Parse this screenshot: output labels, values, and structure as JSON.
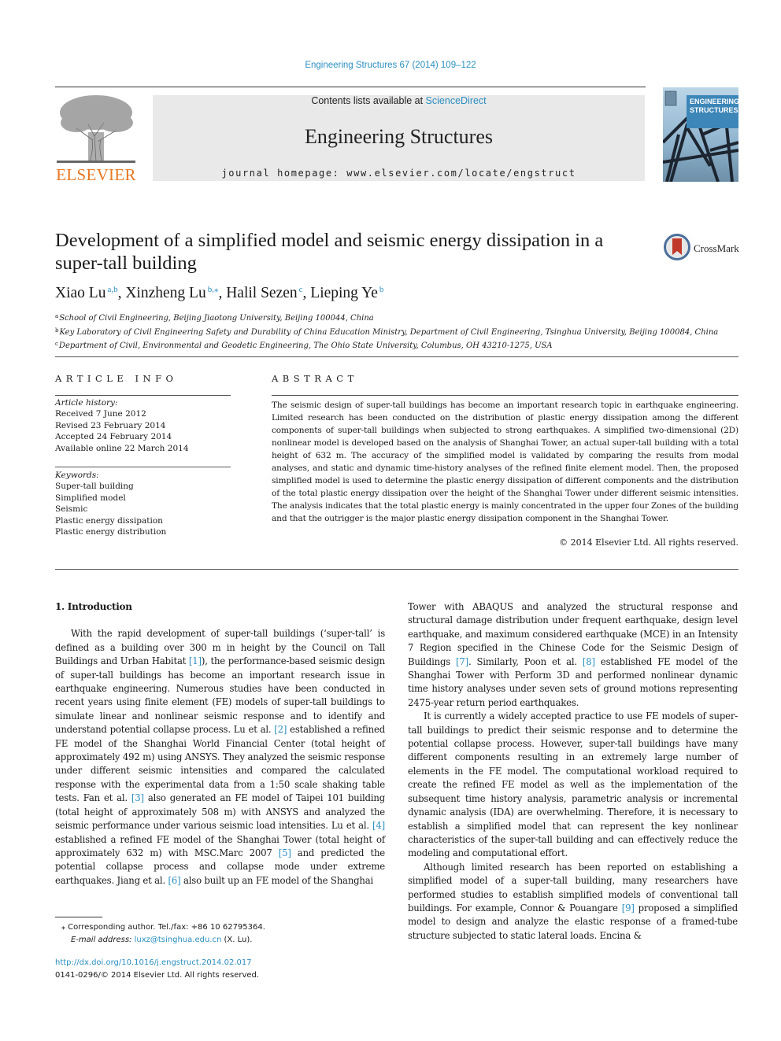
{
  "header": {
    "journal_ref": "Engineering Structures 67 (2014) 109–122",
    "contents_prefix": "Contents lists available at ",
    "contents_link": "ScienceDirect",
    "journal_title": "Engineering Structures",
    "homepage": "journal homepage: www.elsevier.com/locate/engstruct",
    "publisher_logo_text": "ELSEVIER",
    "cover_title_line1": "ENGINEERING",
    "cover_title_line2": "STRUCTURES",
    "crossmark_label": "CrossMark"
  },
  "article": {
    "title": "Development of a simplified model and seismic energy dissipation in a super-tall building",
    "authors": [
      {
        "name": "Xiao Lu",
        "sup": "a,b",
        "sep": ", "
      },
      {
        "name": "Xinzheng Lu",
        "sup": "b,⁎",
        "sep": ", "
      },
      {
        "name": "Halil Sezen",
        "sup": "c",
        "sep": ", "
      },
      {
        "name": "Lieping Ye",
        "sup": "b",
        "sep": ""
      }
    ],
    "affiliations": [
      {
        "key": "a",
        "text": "School of Civil Engineering, Beijing Jiaotong University, Beijing 100044, China"
      },
      {
        "key": "b",
        "text": "Key Laboratory of Civil Engineering Safety and Durability of China Education Ministry, Department of Civil Engineering, Tsinghua University, Beijing 100084, China"
      },
      {
        "key": "c",
        "text": "Department of Civil, Environmental and Geodetic Engineering, The Ohio State University, Columbus, OH 43210-1275, USA"
      }
    ]
  },
  "article_info": {
    "label": "ARTICLE INFO",
    "history_label": "Article history:",
    "history": [
      "Received 7 June 2012",
      "Revised 23 February 2014",
      "Accepted 24 February 2014",
      "Available online 22 March 2014"
    ],
    "keywords_label": "Keywords:",
    "keywords": [
      "Super-tall building",
      "Simplified model",
      "Seismic",
      "Plastic energy dissipation",
      "Plastic energy distribution"
    ]
  },
  "abstract": {
    "label": "ABSTRACT",
    "text": "The seismic design of super-tall buildings has become an important research topic in earthquake engineering. Limited research has been conducted on the distribution of plastic energy dissipation among the different components of super-tall buildings when subjected to strong earthquakes. A simplified two-dimensional (2D) nonlinear model is developed based on the analysis of Shanghai Tower, an actual super-tall building with a total height of 632 m. The accuracy of the simplified model is validated by comparing the results from modal analyses, and static and dynamic time-history analyses of the refined finite element model. Then, the proposed simplified model is used to determine the plastic energy dissipation of different components and the distribution of the total plastic energy dissipation over the height of the Shanghai Tower under different seismic intensities. The analysis indicates that the total plastic energy is mainly concentrated in the upper four Zones of the building and that the outrigger is the major plastic energy dissipation component in the Shanghai Tower.",
    "copyright": "© 2014 Elsevier Ltd. All rights reserved."
  },
  "body": {
    "section_heading": "1. Introduction",
    "left_paragraphs": [
      [
        {
          "t": "With the rapid development of super-tall buildings (‘super-tall’ is defined as a building over 300 m in height by the Council on Tall Buildings and Urban Habitat "
        },
        {
          "ref": "[1]"
        },
        {
          "t": "), the performance-based seismic design of super-tall buildings has become an important research issue in earthquake engineering. Numerous studies have been conducted in recent years using finite element (FE) models of super-tall buildings to simulate linear and nonlinear seismic response and to identify and understand potential collapse process. Lu et al. "
        },
        {
          "ref": "[2]"
        },
        {
          "t": " established a refined FE model of the Shanghai World Financial Center (total height of approximately 492 m) using ANSYS. They analyzed the seismic response under different seismic intensities and compared the calculated response with the experimental data from a 1:50 scale shaking table tests. Fan et al. "
        },
        {
          "ref": "[3]"
        },
        {
          "t": " also generated an FE model of Taipei 101 building (total height of approximately 508 m) with ANSYS and analyzed the seismic performance under various seismic load intensities. Lu et al. "
        },
        {
          "ref": "[4]"
        },
        {
          "t": " established a refined FE model of the Shanghai Tower (total height of approximately 632 m) with MSC.Marc 2007 "
        },
        {
          "ref": "[5]"
        },
        {
          "t": " and predicted the potential collapse process and collapse mode under extreme earthquakes. Jiang et al. "
        },
        {
          "ref": "[6]"
        },
        {
          "t": " also built up an FE model of the Shanghai"
        }
      ]
    ],
    "right_paragraphs": [
      [
        {
          "t": "Tower with ABAQUS and analyzed the structural response and structural damage distribution under frequent earthquake, design level earthquake, and maximum considered earthquake (MCE) in an Intensity 7 Region specified in the Chinese Code for the Seismic Design of Buildings "
        },
        {
          "ref": "[7]"
        },
        {
          "t": ". Similarly, Poon et al. "
        },
        {
          "ref": "[8]"
        },
        {
          "t": " established FE model of the Shanghai Tower with Perform 3D and performed nonlinear dynamic time history analyses under seven sets of ground motions representing 2475-year return period earthquakes."
        }
      ],
      [
        {
          "t": "It is currently a widely accepted practice to use FE models of super-tall buildings to predict their seismic response and to determine the potential collapse process. However, super-tall buildings have many different components resulting in an extremely large number of elements in the FE model. The computational workload required to create the refined FE model as well as the implementation of the subsequent time history analysis, parametric analysis or incremental dynamic analysis (IDA) are overwhelming. Therefore, it is necessary to establish a simplified model that can represent the key nonlinear characteristics of the super-tall building and can effectively reduce the modeling and computational effort."
        }
      ],
      [
        {
          "t": "Although limited research has been reported on establishing a simplified model of a super-tall building, many researchers have performed studies to establish simplified models of conventional tall buildings. For example, Connor & Pouangare "
        },
        {
          "ref": "[9]"
        },
        {
          "t": " proposed a simplified model to design and analyze the elastic response of a framed-tube structure subjected to static lateral loads. Encina &"
        }
      ]
    ]
  },
  "footnote": {
    "corresponding": "⁎  Corresponding author. Tel./fax: +86 10 62795364.",
    "email_label": "E-mail address: ",
    "email": "luxz@tsinghua.edu.cn",
    "email_suffix": " (X. Lu).",
    "doi": "http://dx.doi.org/10.1016/j.engstruct.2014.02.017",
    "issn": "0141-0296/© 2014 Elsevier Ltd. All rights reserved."
  }
}
